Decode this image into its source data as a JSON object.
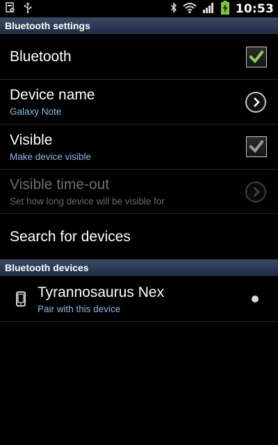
{
  "status_bar": {
    "time": "10:53",
    "icons": [
      "screenshot-icon",
      "usb-icon",
      "bluetooth-icon",
      "wifi-icon",
      "signal-icon",
      "battery-charging-icon"
    ]
  },
  "sections": {
    "settings_header": "Bluetooth settings",
    "devices_header": "Bluetooth devices"
  },
  "settings": {
    "bluetooth": {
      "title": "Bluetooth",
      "checked": true
    },
    "device_name": {
      "title": "Device name",
      "subtitle": "Galaxy Note"
    },
    "visible": {
      "title": "Visible",
      "subtitle": "Make device visible",
      "checked": true
    },
    "visible_timeout": {
      "title": "Visible time-out",
      "subtitle": "Set how long device will be visible for",
      "enabled": false
    },
    "search": {
      "title": "Search for devices"
    }
  },
  "devices": [
    {
      "name": "Tyrannosaurus Nex",
      "subtitle": "Pair with this device",
      "icon": "phone-icon"
    }
  ],
  "colors": {
    "header_bg": "#2a3850",
    "subtitle": "#8fb8e8",
    "check_green": "#8fd14f",
    "check_gray": "#9a9a9a"
  }
}
